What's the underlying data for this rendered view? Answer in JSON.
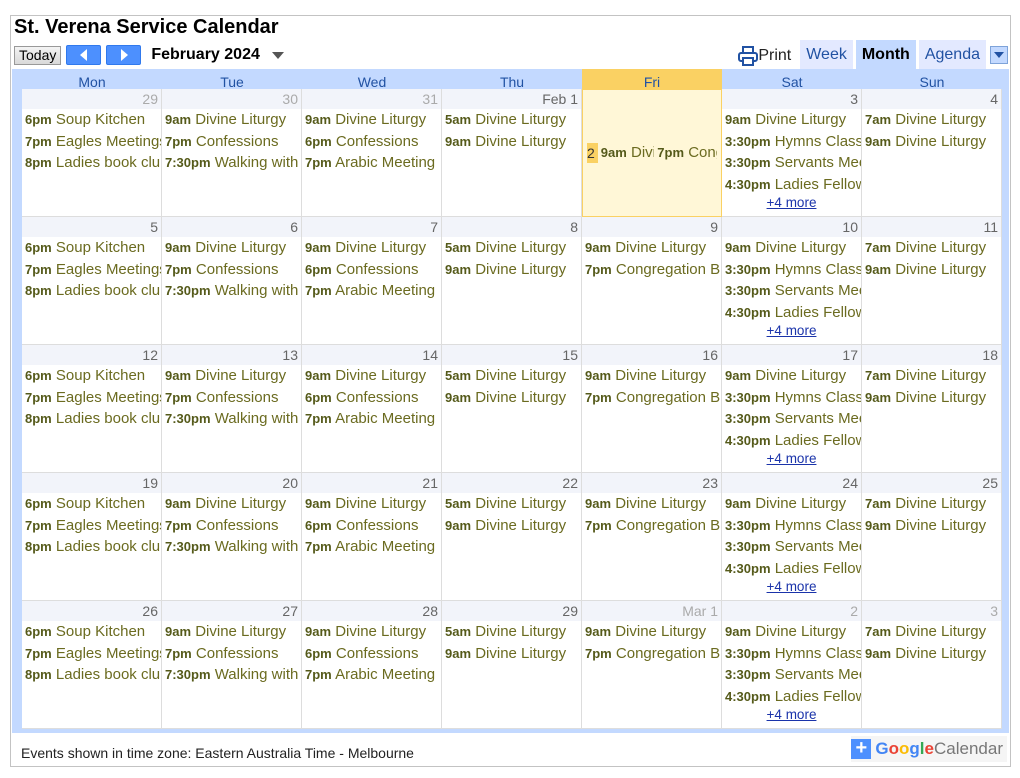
{
  "title": "St. Verena Service Calendar",
  "nav": {
    "today_label": "Today",
    "month_label": "February 2024"
  },
  "tabs": {
    "print_label": "Print",
    "week": "Week",
    "month": "Month",
    "agenda": "Agenda"
  },
  "day_headers": [
    "Mon",
    "Tue",
    "Wed",
    "Thu",
    "Fri",
    "Sat",
    "Sun"
  ],
  "today_column": 4,
  "weeks": [
    {
      "days": [
        "29",
        "30",
        "31",
        "Feb 1",
        "2",
        "3",
        "4"
      ],
      "other": [
        true,
        true,
        true,
        false,
        false,
        false,
        false
      ],
      "today": 4
    },
    {
      "days": [
        "5",
        "6",
        "7",
        "8",
        "9",
        "10",
        "11"
      ],
      "other": [
        false,
        false,
        false,
        false,
        false,
        false,
        false
      ],
      "today": -1
    },
    {
      "days": [
        "12",
        "13",
        "14",
        "15",
        "16",
        "17",
        "18"
      ],
      "other": [
        false,
        false,
        false,
        false,
        false,
        false,
        false
      ],
      "today": -1
    },
    {
      "days": [
        "19",
        "20",
        "21",
        "22",
        "23",
        "24",
        "25"
      ],
      "other": [
        false,
        false,
        false,
        false,
        false,
        false,
        false
      ],
      "today": -1
    },
    {
      "days": [
        "26",
        "27",
        "28",
        "29",
        "Mar 1",
        "2",
        "3"
      ],
      "other": [
        false,
        false,
        false,
        false,
        true,
        true,
        true
      ],
      "today": -1
    }
  ],
  "weekday_events": [
    [
      {
        "t": "6pm",
        "n": "Soup Kitchen"
      },
      {
        "t": "7pm",
        "n": "Eagles Meetings"
      },
      {
        "t": "8pm",
        "n": "Ladies book club"
      }
    ],
    [
      {
        "t": "9am",
        "n": "Divine Liturgy"
      },
      {
        "t": "7pm",
        "n": "Confessions"
      },
      {
        "t": "7:30pm",
        "n": "Walking with"
      }
    ],
    [
      {
        "t": "9am",
        "n": "Divine Liturgy"
      },
      {
        "t": "6pm",
        "n": "Confessions"
      },
      {
        "t": "7pm",
        "n": "Arabic Meeting"
      }
    ],
    [
      {
        "t": "5am",
        "n": "Divine Liturgy"
      },
      {
        "t": "9am",
        "n": "Divine Liturgy"
      }
    ],
    [
      {
        "t": "9am",
        "n": "Divine Liturgy"
      },
      {
        "t": "7pm",
        "n": "Congregation B"
      }
    ],
    [
      {
        "t": "9am",
        "n": "Divine Liturgy"
      },
      {
        "t": "3:30pm",
        "n": "Hymns Class"
      },
      {
        "t": "3:30pm",
        "n": "Servants Meeting"
      },
      {
        "t": "4:30pm",
        "n": "Ladies Fellowship"
      }
    ],
    [
      {
        "t": "7am",
        "n": "Divine Liturgy"
      },
      {
        "t": "9am",
        "n": "Divine Liturgy"
      }
    ]
  ],
  "saturday_more": "+4 more",
  "footer": "Events shown in time zone: Eastern Australia Time - Melbourne",
  "gcal": {
    "plus": "+",
    "google_letters": [
      "G",
      "o",
      "o",
      "g",
      "l",
      "e"
    ],
    "word": "Calendar"
  },
  "colors": {
    "accent": "#c3d9ff",
    "today": "#fad163",
    "event_text": "#6b6b20",
    "nav_button": "#4d90fe"
  }
}
